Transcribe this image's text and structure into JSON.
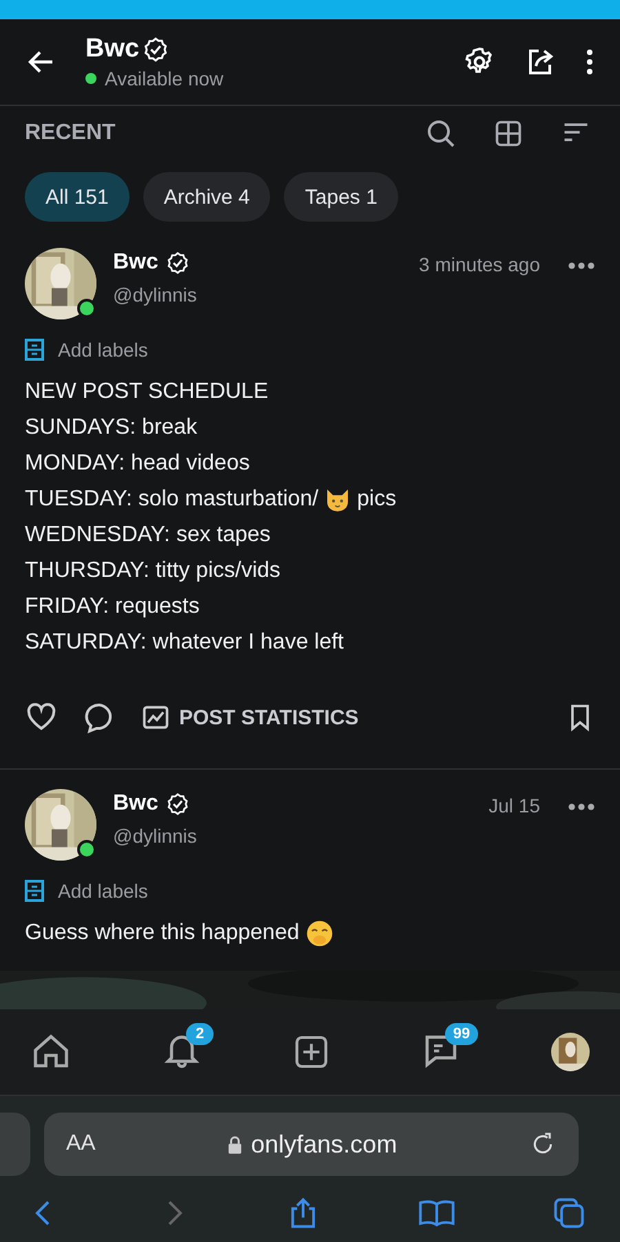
{
  "header": {
    "name": "Bwc",
    "verified": true,
    "status": "Available now",
    "online": true
  },
  "section": {
    "title": "RECENT"
  },
  "chips": [
    {
      "label": "All 151",
      "selected": true
    },
    {
      "label": "Archive 4",
      "selected": false
    },
    {
      "label": "Tapes 1",
      "selected": false
    }
  ],
  "posts": [
    {
      "name": "Bwc",
      "handle": "@dylinnis",
      "time": "3 minutes ago",
      "online": true,
      "labels_action": "Add labels",
      "lines": [
        {
          "kind": "plain",
          "text": "NEW POST SCHEDULE"
        },
        {
          "kind": "plain",
          "text": "SUNDAYS: break"
        },
        {
          "kind": "plain",
          "text": "MONDAY: head videos"
        },
        {
          "kind": "cat",
          "text": "TUESDAY: solo masturbation/",
          "after": " pics"
        },
        {
          "kind": "plain",
          "text": "WEDNESDAY: sex tapes"
        },
        {
          "kind": "plain",
          "text": "THURSDAY: titty pics/vids"
        },
        {
          "kind": "plain",
          "text": "FRIDAY: requests"
        },
        {
          "kind": "plain",
          "text": "SATURDAY: whatever I have left"
        }
      ],
      "stats_label": "POST STATISTICS"
    },
    {
      "name": "Bwc",
      "handle": "@dylinnis",
      "time": "Jul 15",
      "online": true,
      "labels_action": "Add labels",
      "lines": [
        {
          "kind": "smile",
          "text": "Guess where this happened"
        }
      ]
    }
  ],
  "nav": {
    "notifications_badge": "2",
    "messages_badge": "99"
  },
  "browser": {
    "text_size": "AA",
    "url": "onlyfans.com"
  }
}
